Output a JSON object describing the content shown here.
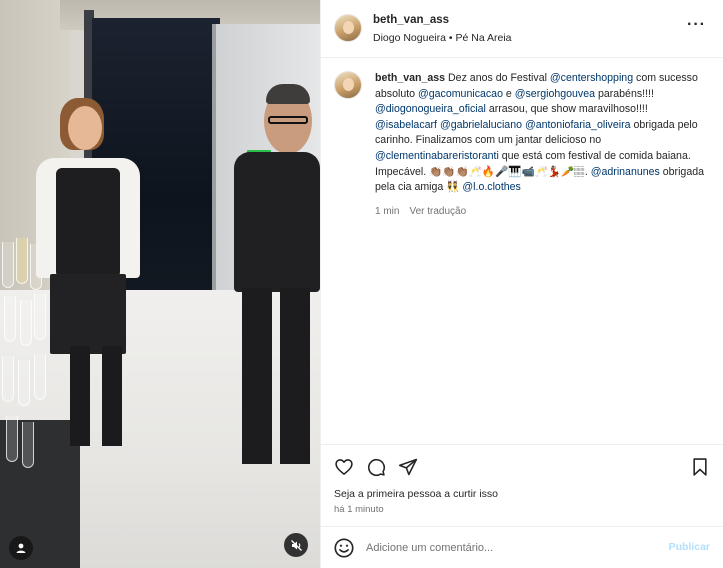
{
  "media": {
    "user_tag_icon": "person-tag-icon",
    "mute_icon": "muted-speaker-icon"
  },
  "header": {
    "username": "beth_van_ass",
    "subtitle": "Diogo Nogueira • Pé Na Areia",
    "more_icon": "more-horizontal-icon"
  },
  "caption": {
    "username": "beth_van_ass",
    "t1": " Dez anos do Festival ",
    "m1": "@centershopping",
    "t2": " com sucesso absoluto ",
    "m2": "@gacomunicacao",
    "t3": " e ",
    "m3": "@sergiohgouvea",
    "t4": " parabéns!!!! ",
    "m4": "@diogonogueira_oficial",
    "t5": " arrasou, que show maravilhoso!!!! ",
    "m5": "@isabelacarf",
    "t6": " ",
    "m6": "@gabrielaluciano",
    "t7": " ",
    "m7": "@antoniofaria_oliveira",
    "t8": " obrigada pelo carinho. Finalizamos com um jantar delicioso no ",
    "m8": "@clementinabareristoranti",
    "t9": " que está com festival de comida baiana. Impecável. 👏🏽👏🏽👏🏽🥂🔥🎤🎹📹🥂💃🏽🥕🏽. ",
    "m9": "@adrinanunes",
    "t10": " obrigada pela cia amiga 👯 ",
    "m10": "@l.o.clothes"
  },
  "meta": {
    "time": "1 min",
    "translate": "Ver tradução"
  },
  "actions": {
    "like_icon": "heart-icon",
    "comment_icon": "comment-icon",
    "share_icon": "send-icon",
    "save_icon": "bookmark-icon"
  },
  "likes_text": "Seja a primeira pessoa a curtir isso",
  "time_ago": "há 1 minuto",
  "add_comment": {
    "emoji_icon": "emoji-icon",
    "placeholder": "Adicione um comentário...",
    "publish_label": "Publicar"
  },
  "colors": {
    "link": "#00376b",
    "publish_disabled": "#b2dffc",
    "secondary_text": "#737373"
  }
}
